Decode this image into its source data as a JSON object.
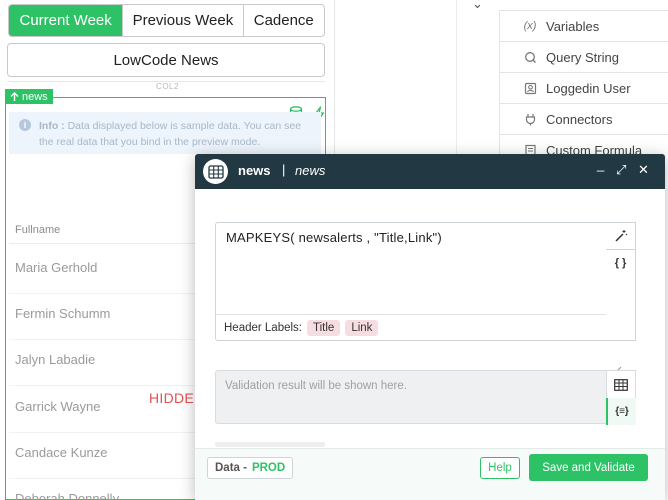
{
  "segments": {
    "items": [
      "Current Week",
      "Previous Week",
      "Cadence"
    ],
    "active_index": 0
  },
  "news_button": "LowCode News",
  "column_label": "COL2",
  "news_widget": {
    "tag": "news",
    "info_prefix": "Info : ",
    "info_text": "Data displayed below is sample data. You can see the real data that you bind in the preview mode.",
    "column_header": "Fullname",
    "rows": [
      "Maria Gerhold",
      "Fermin Schumm",
      "Jalyn Labadie",
      "Garrick Wayne",
      "Candace Kunze",
      "Deborah Donnelly"
    ],
    "hidden_label": "HIDDEN"
  },
  "right_panel": {
    "items": [
      {
        "label": "Variables",
        "icon": "variable-icon"
      },
      {
        "label": "Query String",
        "icon": "query-icon"
      },
      {
        "label": "Loggedin User",
        "icon": "user-icon"
      },
      {
        "label": "Connectors",
        "icon": "plug-icon"
      },
      {
        "label": "Custom Formula",
        "icon": "formula-icon"
      }
    ]
  },
  "modal": {
    "title": "news",
    "separator": "|",
    "subtitle": "news",
    "controls": {
      "minimize": "_",
      "expand": "⤢",
      "close": "✕"
    },
    "formula": "MAPKEYS( newsalerts , \"Title,Link\")",
    "header_labels_prefix": "Header Labels:",
    "header_labels": [
      "Title",
      "Link"
    ],
    "validation_placeholder": "Validation result will be shown here.",
    "data_label": "Data -",
    "data_env": "PROD",
    "help_label": "Help",
    "save_label": "Save and Validate"
  },
  "colors": {
    "accent": "#2ec266",
    "modal_header": "#223843",
    "hidden_red": "#e05252",
    "chip_bg": "#f6dde1"
  }
}
